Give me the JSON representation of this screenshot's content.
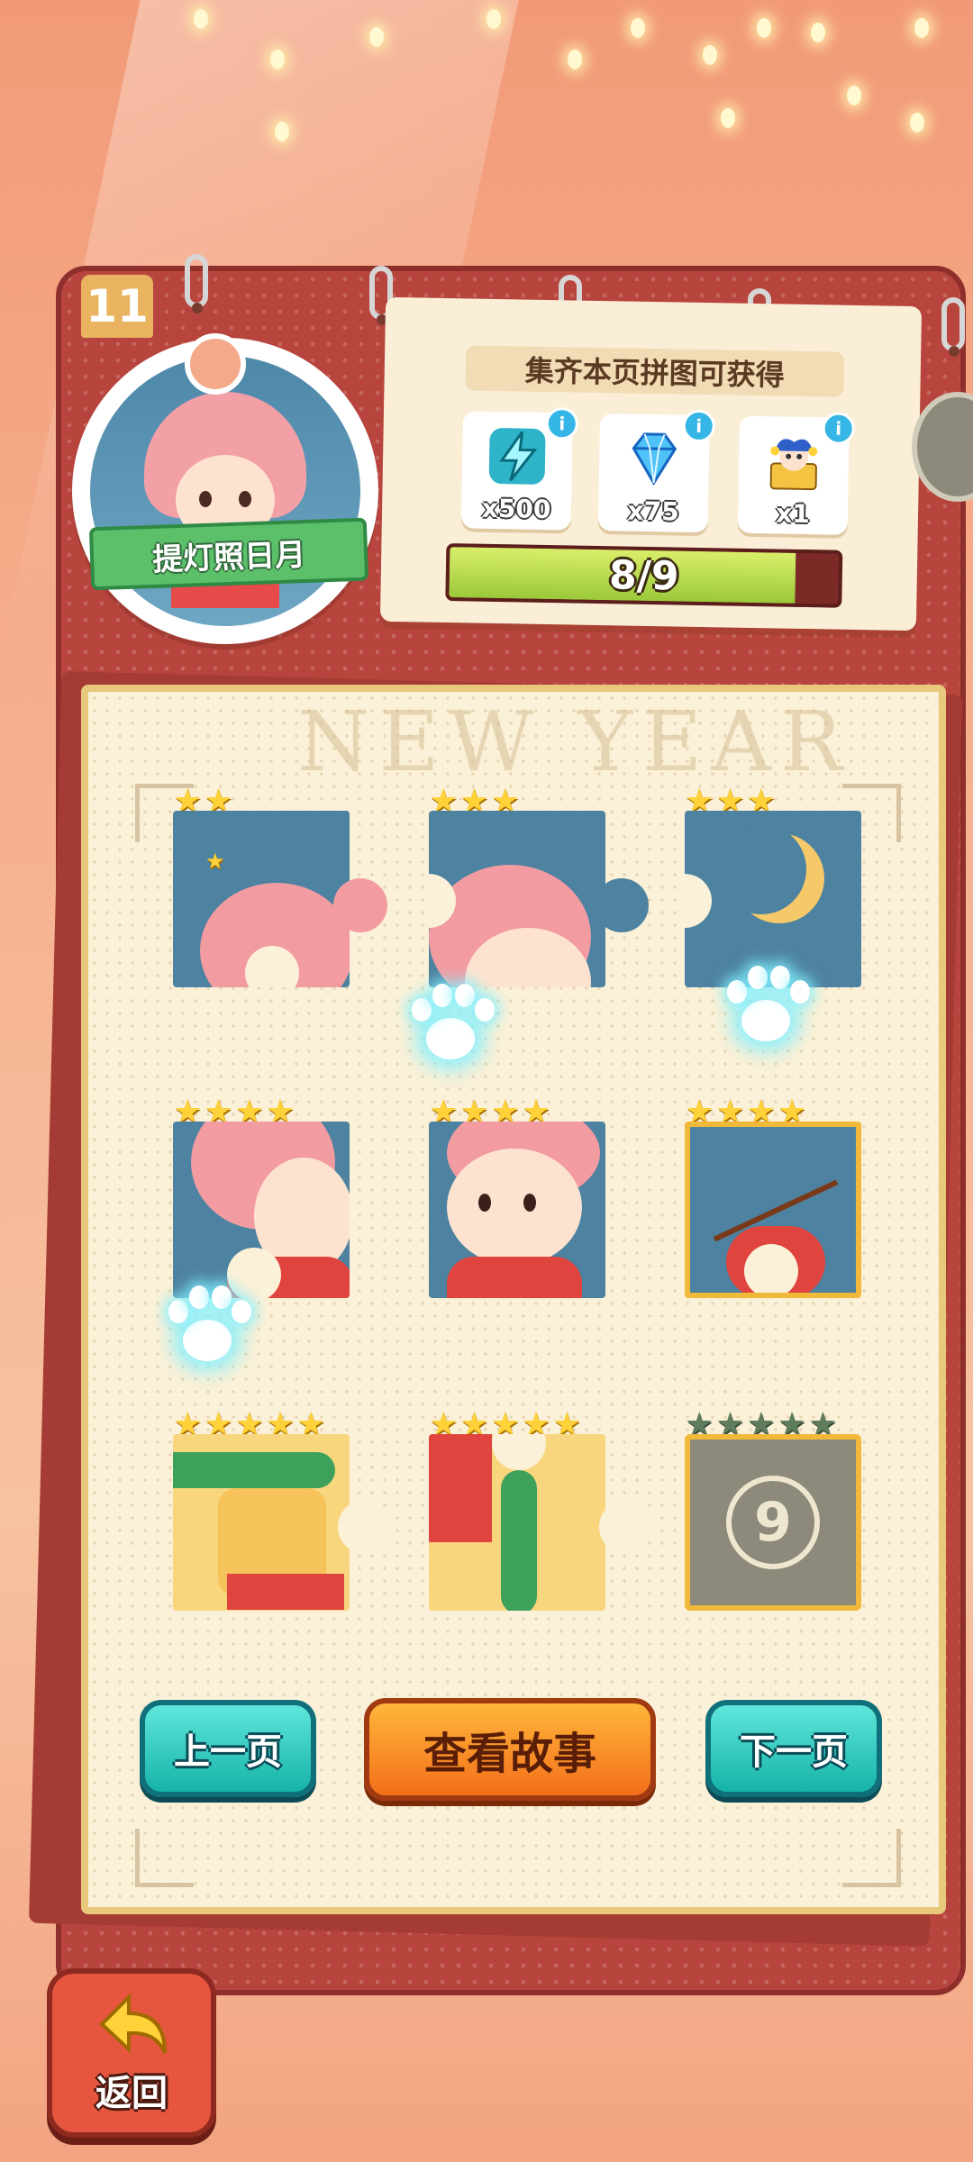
{
  "chapter": {
    "page_number": "11",
    "badge_title": "提灯照日月"
  },
  "reward_panel": {
    "title": "集齐本页拼图可获得",
    "rewards": [
      {
        "icon": "lightning-energy-icon",
        "qty": "x500"
      },
      {
        "icon": "blue-diamond-icon",
        "qty": "x75"
      },
      {
        "icon": "jester-character-icon",
        "qty": "x1"
      }
    ],
    "info_label": "i",
    "progress_text": "8/9",
    "progress_fraction": 0.89
  },
  "page": {
    "watermark": "NEW YEAR"
  },
  "pieces": [
    {
      "stars": 2,
      "max_stars": 2,
      "locked": false
    },
    {
      "stars": 3,
      "max_stars": 3,
      "locked": false
    },
    {
      "stars": 3,
      "max_stars": 3,
      "locked": false
    },
    {
      "stars": 4,
      "max_stars": 4,
      "locked": false
    },
    {
      "stars": 4,
      "max_stars": 4,
      "locked": false
    },
    {
      "stars": 4,
      "max_stars": 4,
      "locked": false
    },
    {
      "stars": 5,
      "max_stars": 5,
      "locked": false
    },
    {
      "stars": 5,
      "max_stars": 5,
      "locked": false
    },
    {
      "stars": 0,
      "max_stars": 5,
      "locked": true,
      "number": "9"
    }
  ],
  "buttons": {
    "prev": "上一页",
    "story": "查看故事",
    "next": "下一页",
    "back": "返回"
  },
  "colors": {
    "teal": "#16b3a8",
    "orange": "#f36f1a",
    "board": "#b8453d",
    "progress": "#9bc93a"
  }
}
